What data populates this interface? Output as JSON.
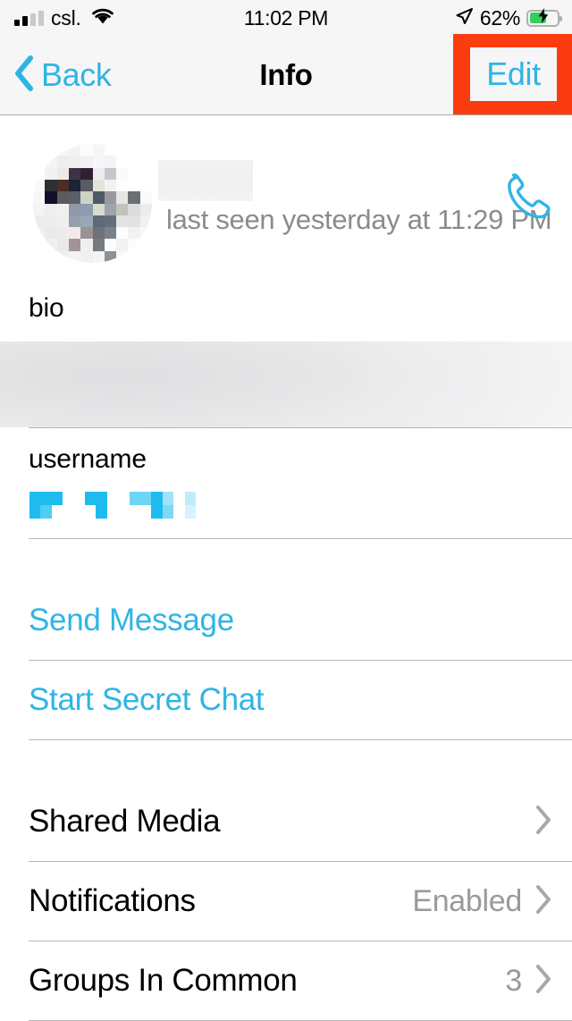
{
  "status_bar": {
    "carrier": "csl.",
    "time": "11:02 PM",
    "battery_percent": "62%",
    "signal_bars_filled": 2,
    "signal_bars_total": 4,
    "wifi_icon": "wifi-icon",
    "location_icon": "location-arrow-icon",
    "battery_icon": "battery-charging-icon",
    "charging": true
  },
  "nav_bar": {
    "back_label": "Back",
    "back_icon": "chevron-left-icon",
    "title": "Info",
    "edit_label": "Edit",
    "highlight_color": "#FA3C10"
  },
  "profile": {
    "avatar": "pixelated-avatar-image",
    "name_redacted": true,
    "status": "last seen yesterday at 11:29 PM",
    "call_icon": "phone-icon"
  },
  "fields": {
    "bio_label": "bio",
    "bio_value_redacted": true,
    "username_label": "username",
    "username_value_redacted": true
  },
  "actions": [
    {
      "label": "Send Message",
      "name": "send-message-button"
    },
    {
      "label": "Start Secret Chat",
      "name": "start-secret-chat-button"
    }
  ],
  "list_rows": [
    {
      "label": "Shared Media",
      "value": "",
      "name": "shared-media-row"
    },
    {
      "label": "Notifications",
      "value": "Enabled",
      "name": "notifications-row"
    },
    {
      "label": "Groups In Common",
      "value": "3",
      "name": "groups-in-common-row"
    }
  ],
  "colors": {
    "accent": "#2EB5E5",
    "highlight": "#FA3C10",
    "bar_background": "#F6F6F6",
    "secondary_text": "#8b8b8b"
  }
}
